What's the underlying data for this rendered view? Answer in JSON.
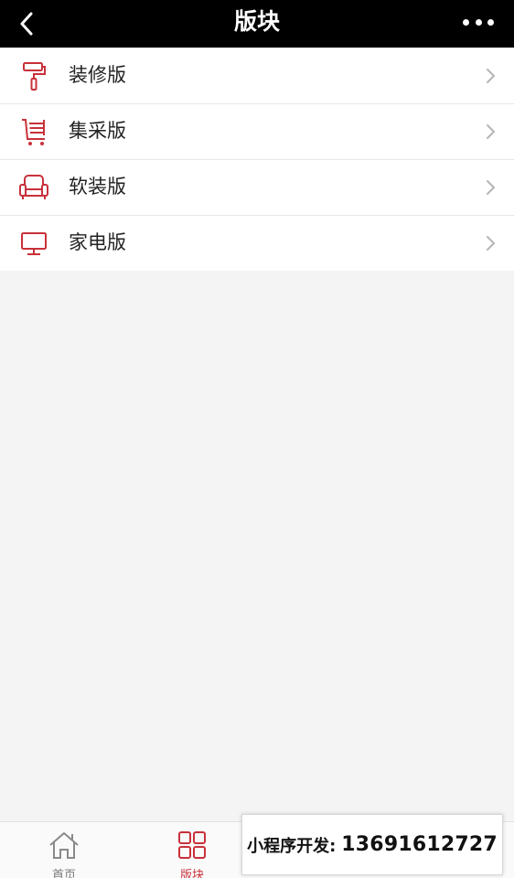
{
  "header": {
    "title": "版块"
  },
  "list": {
    "items": [
      {
        "label": "装修版",
        "icon": "paint-roller-icon"
      },
      {
        "label": "集采版",
        "icon": "shopping-cart-icon"
      },
      {
        "label": "软装版",
        "icon": "armchair-icon"
      },
      {
        "label": "家电版",
        "icon": "monitor-icon"
      }
    ]
  },
  "tabbar": {
    "tabs": [
      {
        "label": "首页",
        "icon": "home-icon"
      },
      {
        "label": "版块",
        "icon": "grid-icon",
        "active": true
      },
      {
        "label": "",
        "icon": ""
      },
      {
        "label": "",
        "icon": ""
      }
    ]
  },
  "promo": {
    "label": "小程序开发:",
    "phone": "13691612727"
  },
  "colors": {
    "accent": "#c8313a",
    "header_bg": "#000000",
    "page_bg": "#f4f4f4"
  }
}
